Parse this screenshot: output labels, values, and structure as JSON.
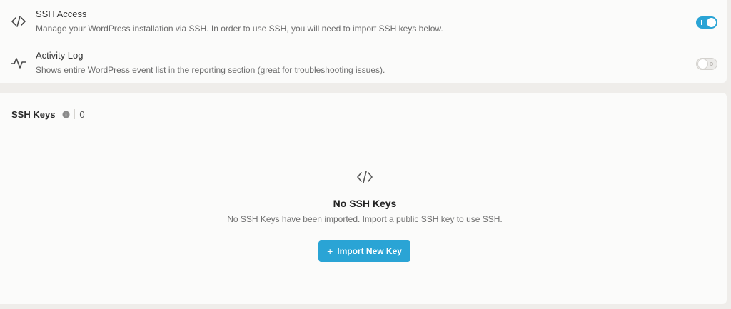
{
  "settings": {
    "ssh_access": {
      "title": "SSH Access",
      "description": "Manage your WordPress installation via SSH. In order to use SSH, you will need to import SSH keys below.",
      "icon": "code-icon",
      "enabled": true
    },
    "activity_log": {
      "title": "Activity Log",
      "description": "Shows entire WordPress event list in the reporting section (great for troubleshooting issues).",
      "icon": "activity-icon",
      "enabled": false
    }
  },
  "ssh_keys": {
    "title": "SSH Keys",
    "count": "0",
    "empty_state": {
      "icon": "code-icon",
      "title": "No SSH Keys",
      "description": "No SSH Keys have been imported. Import a public SSH key to use SSH."
    },
    "import_button": {
      "plus": "+",
      "label": "Import New Key"
    }
  },
  "colors": {
    "accent": "#2aa4d5",
    "background": "#efedea",
    "card": "#fbfbfa"
  }
}
